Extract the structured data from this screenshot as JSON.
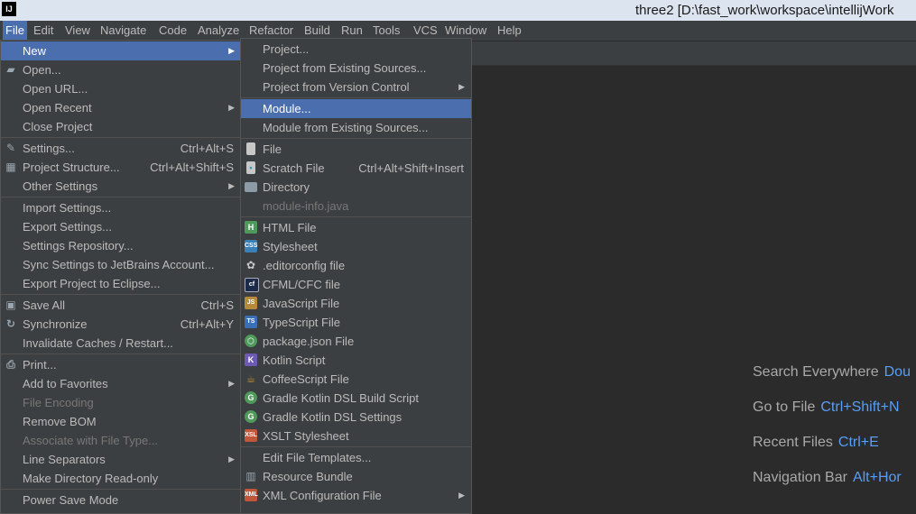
{
  "window": {
    "title": "three2 [D:\\fast_work\\workspace\\intellijWork",
    "app_icon": "IJ"
  },
  "menubar": [
    {
      "label": "File",
      "active": true
    },
    {
      "label": "Edit"
    },
    {
      "label": "View"
    },
    {
      "label": "Navigate"
    },
    {
      "label": "Code"
    },
    {
      "label": "Analyze"
    },
    {
      "label": "Refactor"
    },
    {
      "label": "Build"
    },
    {
      "label": "Run"
    },
    {
      "label": "Tools"
    },
    {
      "label": "VCS"
    },
    {
      "label": "Window"
    },
    {
      "label": "Help"
    }
  ],
  "file_menu": [
    {
      "label": "New",
      "submenu": true,
      "selected": true
    },
    {
      "label": "Open...",
      "icon": "folder-icon"
    },
    {
      "label": "Open URL..."
    },
    {
      "label": "Open Recent",
      "submenu": true
    },
    {
      "label": "Close Project"
    },
    {
      "label": "Settings...",
      "shortcut": "Ctrl+Alt+S",
      "icon": "wrench-icon"
    },
    {
      "label": "Project Structure...",
      "shortcut": "Ctrl+Alt+Shift+S",
      "icon": "project-structure-icon"
    },
    {
      "label": "Other Settings",
      "submenu": true
    },
    {
      "label": "Import Settings..."
    },
    {
      "label": "Export Settings..."
    },
    {
      "label": "Settings Repository..."
    },
    {
      "label": "Sync Settings to JetBrains Account..."
    },
    {
      "label": "Export Project to Eclipse..."
    },
    {
      "label": "Save All",
      "shortcut": "Ctrl+S",
      "icon": "save-icon"
    },
    {
      "label": "Synchronize",
      "shortcut": "Ctrl+Alt+Y",
      "icon": "sync-icon"
    },
    {
      "label": "Invalidate Caches / Restart..."
    },
    {
      "label": "Print...",
      "icon": "print-icon"
    },
    {
      "label": "Add to Favorites",
      "submenu": true
    },
    {
      "label": "File Encoding",
      "disabled": true
    },
    {
      "label": "Remove BOM"
    },
    {
      "label": "Associate with File Type...",
      "disabled": true
    },
    {
      "label": "Line Separators",
      "submenu": true
    },
    {
      "label": "Make Directory Read-only"
    },
    {
      "label": "Power Save Mode"
    }
  ],
  "new_menu": [
    {
      "label": "Project..."
    },
    {
      "label": "Project from Existing Sources..."
    },
    {
      "label": "Project from Version Control",
      "submenu": true
    },
    {
      "label": "Module...",
      "selected": true
    },
    {
      "label": "Module from Existing Sources..."
    },
    {
      "label": "File",
      "icon": "file-icon"
    },
    {
      "label": "Scratch File",
      "shortcut": "Ctrl+Alt+Shift+Insert",
      "icon": "scratch-file-icon"
    },
    {
      "label": "Directory",
      "icon": "directory-icon"
    },
    {
      "label": "module-info.java",
      "disabled": true
    },
    {
      "label": "HTML File",
      "icon": "html-file-icon"
    },
    {
      "label": "Stylesheet",
      "icon": "css-file-icon"
    },
    {
      "label": ".editorconfig file",
      "icon": "editorconfig-icon"
    },
    {
      "label": "CFML/CFC file",
      "icon": "cfml-file-icon"
    },
    {
      "label": "JavaScript File",
      "icon": "javascript-file-icon"
    },
    {
      "label": "TypeScript File",
      "icon": "typescript-file-icon"
    },
    {
      "label": "package.json File",
      "icon": "nodejs-icon"
    },
    {
      "label": "Kotlin Script",
      "icon": "kotlin-icon"
    },
    {
      "label": "CoffeeScript File",
      "icon": "coffeescript-icon"
    },
    {
      "label": "Gradle Kotlin DSL Build Script",
      "icon": "gradle-icon"
    },
    {
      "label": "Gradle Kotlin DSL Settings",
      "icon": "gradle-icon"
    },
    {
      "label": "XSLT Stylesheet",
      "icon": "xslt-icon"
    },
    {
      "label": "Edit File Templates..."
    },
    {
      "label": "Resource Bundle",
      "icon": "resource-bundle-icon"
    },
    {
      "label": "XML Configuration File",
      "submenu": true,
      "icon": "xml-icon"
    }
  ],
  "hints": [
    {
      "label": "Search Everywhere",
      "key": "Dou"
    },
    {
      "label": "Go to File",
      "key": "Ctrl+Shift+N"
    },
    {
      "label": "Recent Files",
      "key": "Ctrl+E"
    },
    {
      "label": "Navigation Bar",
      "key": "Alt+Hor"
    }
  ],
  "colors": {
    "accent": "#4b6eaf",
    "link": "#589df6",
    "background": "#2b2b2b",
    "menu": "#3c3f41"
  }
}
